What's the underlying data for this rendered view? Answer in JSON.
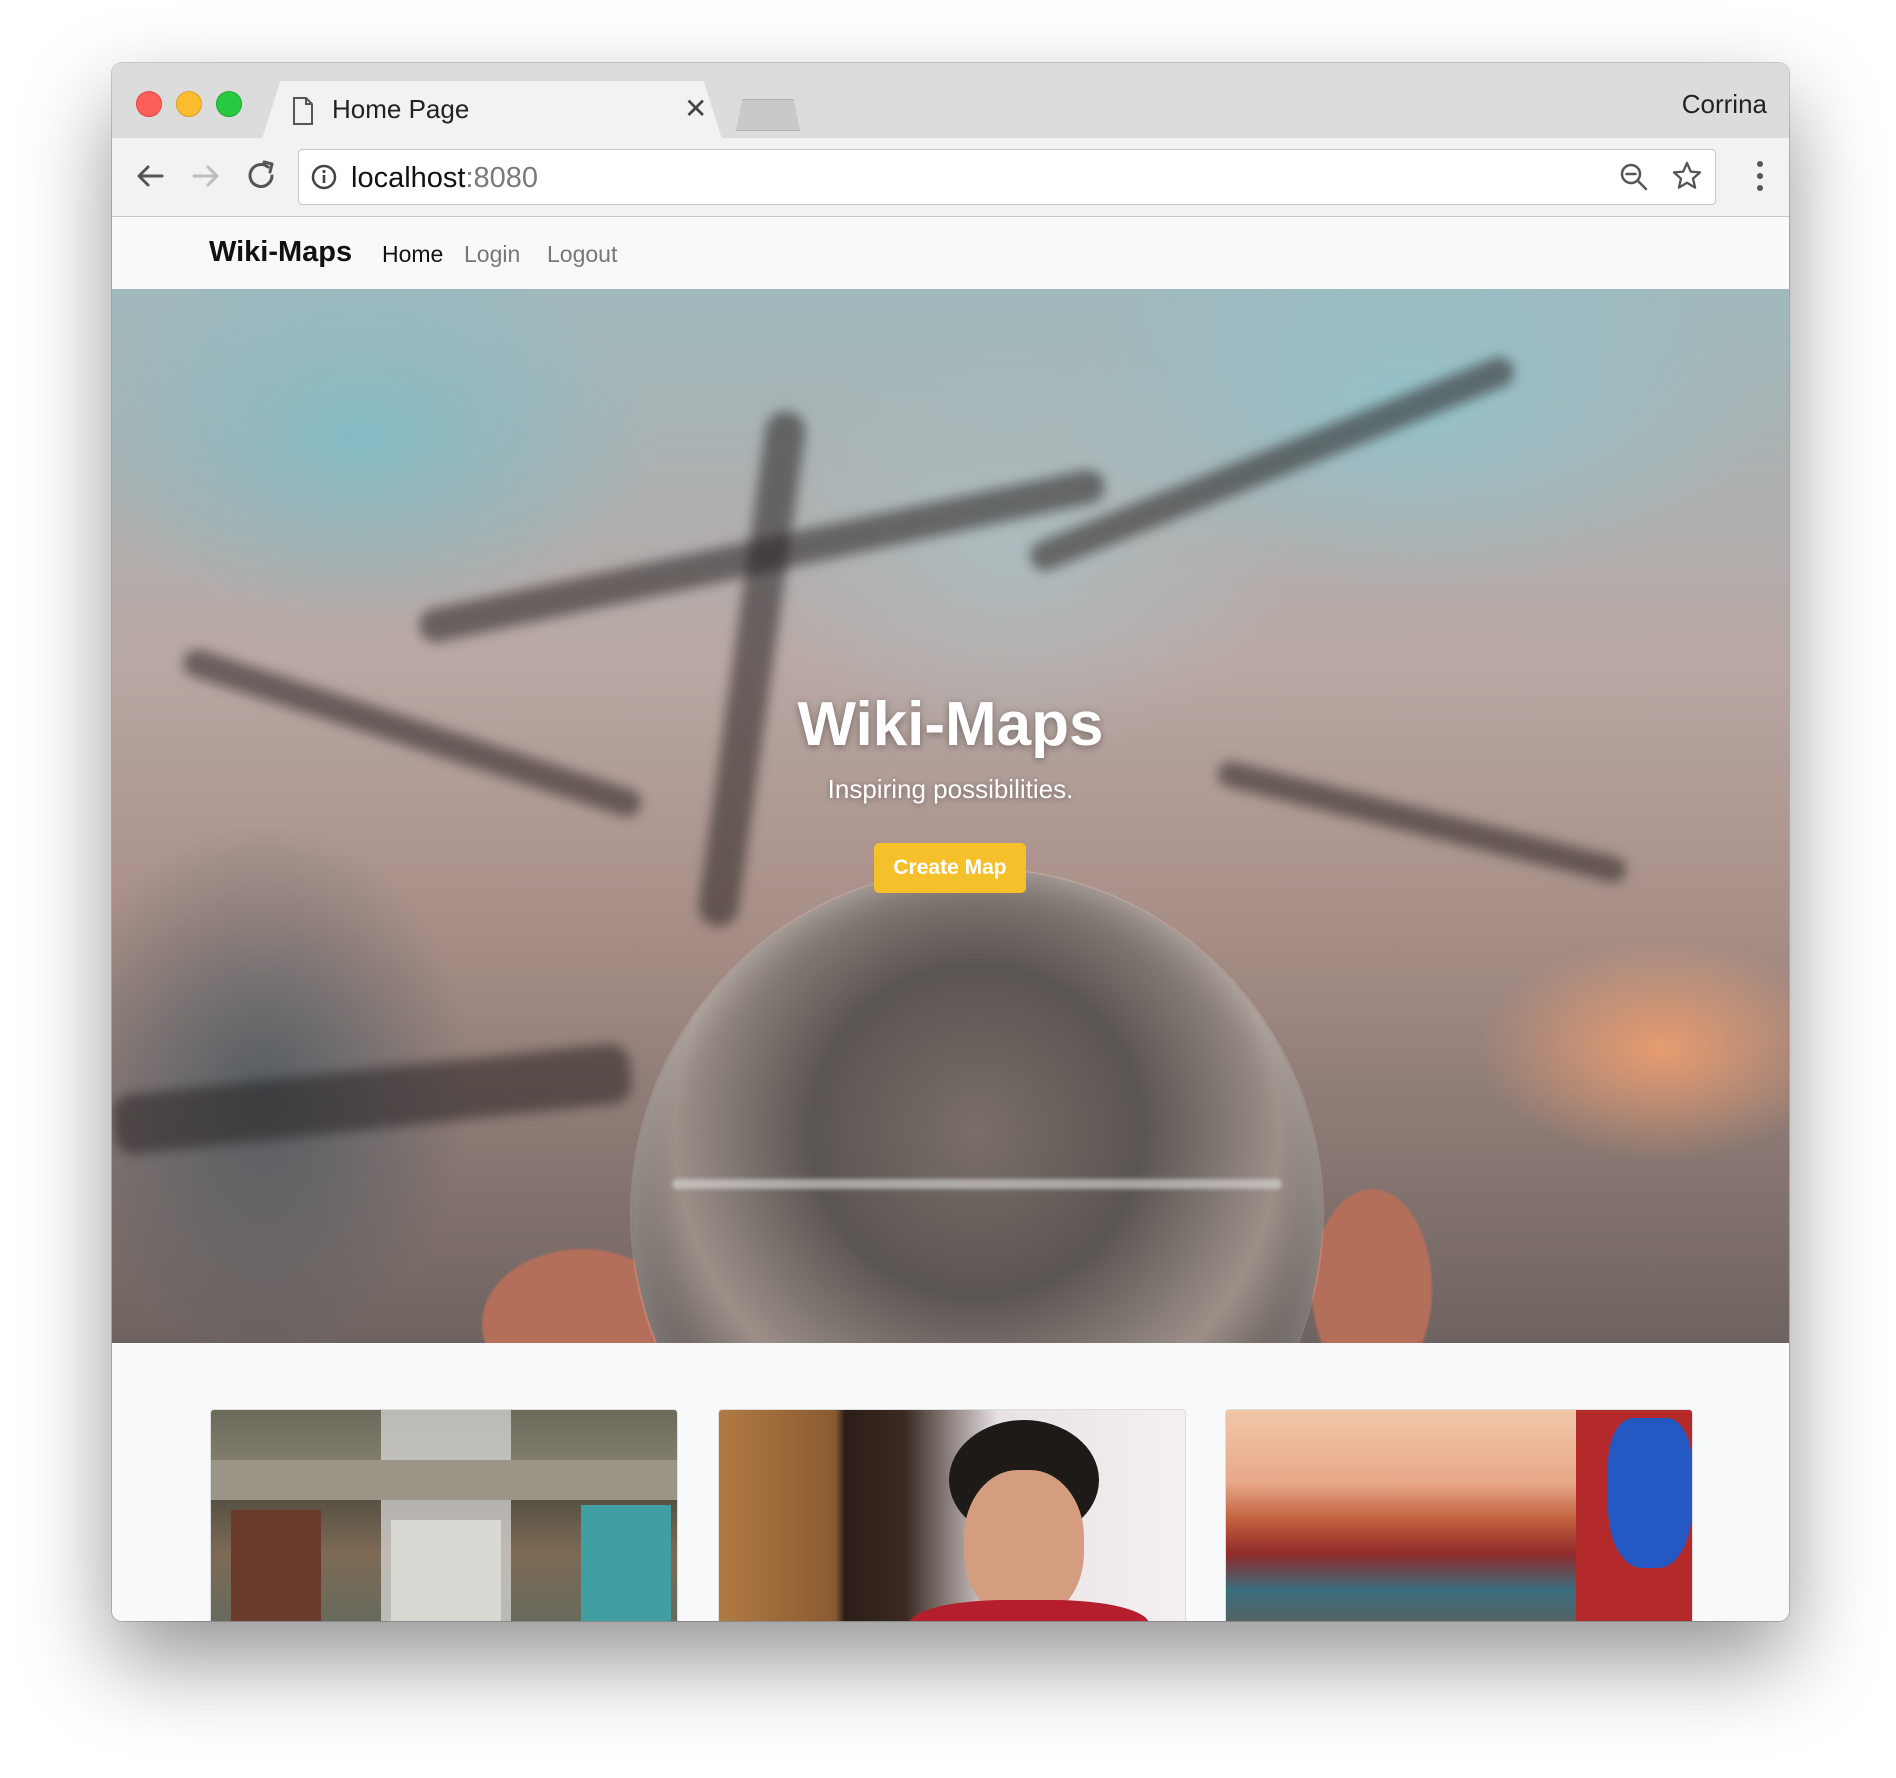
{
  "browser": {
    "tab_title": "Home Page",
    "profile_name": "Corrina",
    "url_host": "localhost",
    "url_port": ":8080",
    "icons": [
      "page-icon",
      "tab-close-icon",
      "back-icon",
      "forward-icon",
      "reload-icon",
      "info-icon",
      "zoom-icon",
      "star-icon",
      "kebab-menu-icon"
    ]
  },
  "nav": {
    "brand": "Wiki-Maps",
    "links": [
      "Home",
      "Login",
      "Logout"
    ],
    "active": "Home"
  },
  "hero": {
    "title": "Wiki-Maps",
    "subtitle": "Inspiring possibilities.",
    "button_label": "Create Map",
    "button_color": "#f6c02a"
  },
  "cards": [
    {
      "image": "aerial-city-photo"
    },
    {
      "image": "girl-eating-photo"
    },
    {
      "image": "temple-backpack-photo"
    }
  ]
}
